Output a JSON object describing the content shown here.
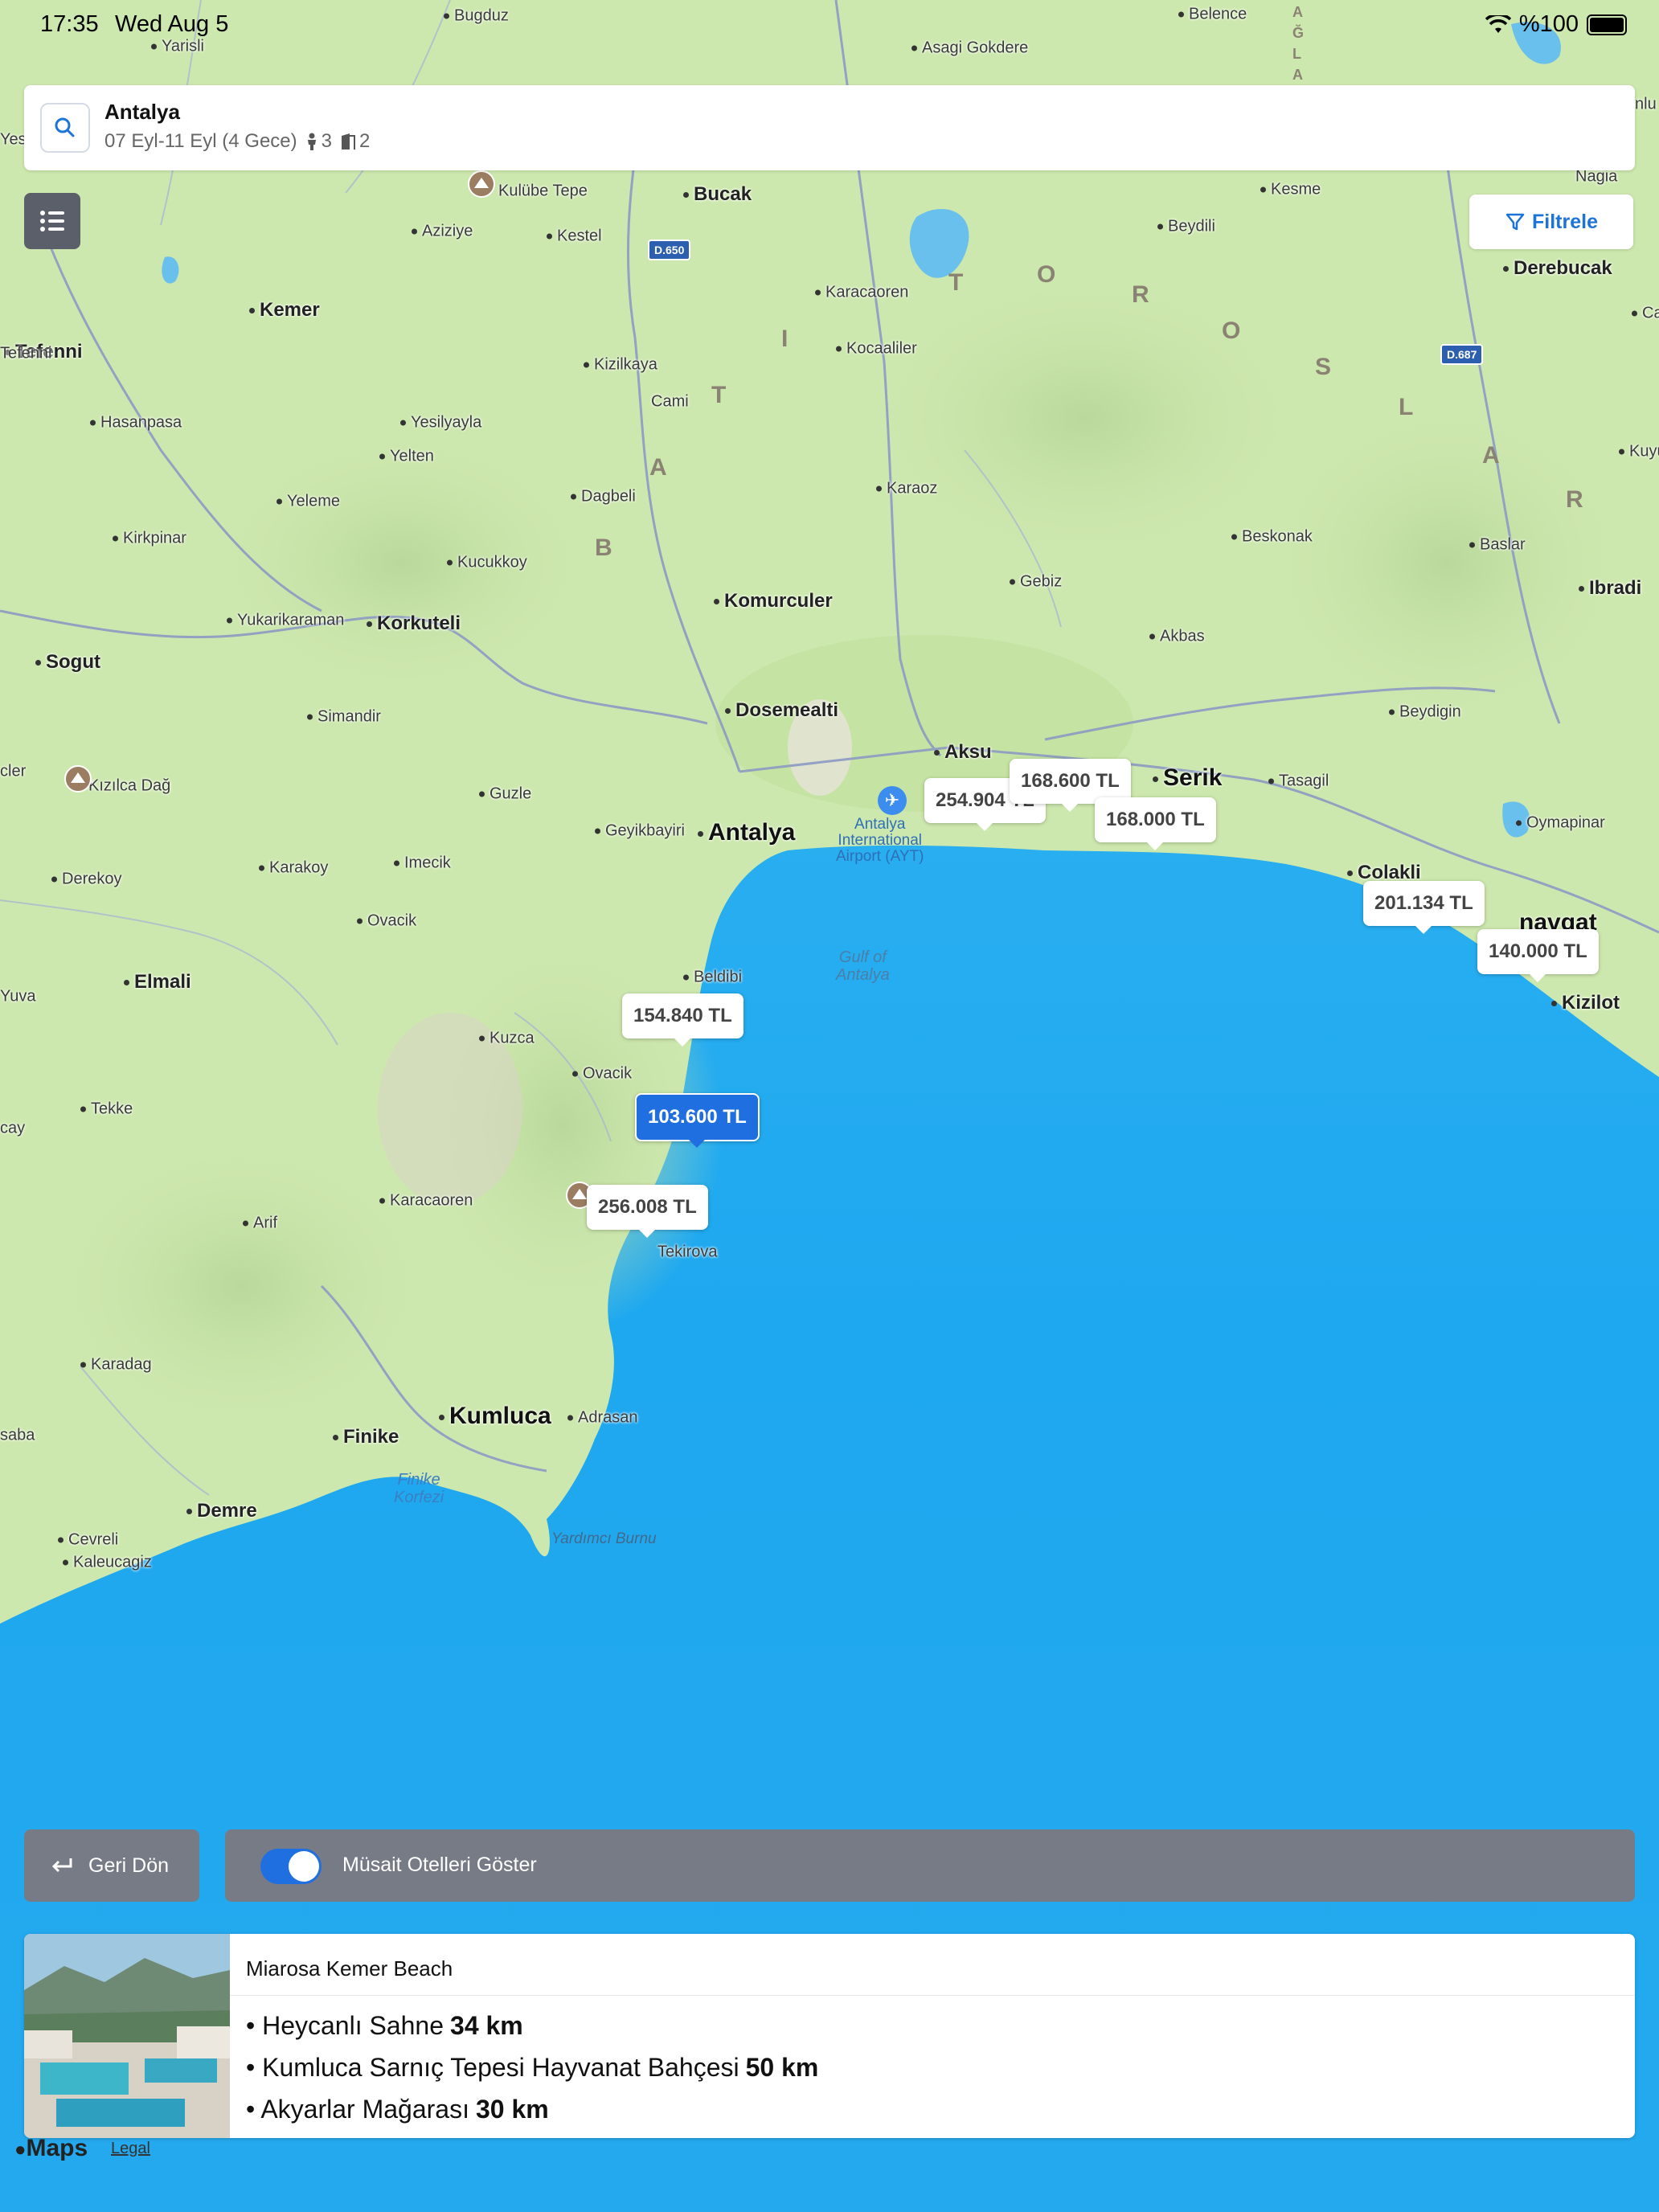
{
  "status_bar": {
    "time": "17:35",
    "date": "Wed Aug 5",
    "battery": "%100"
  },
  "search": {
    "title": "Antalya",
    "dates": "07 Eyl-11 Eyl (4 Gece)",
    "adults": "3",
    "rooms": "2"
  },
  "filter_label": "Filtrele",
  "map": {
    "places": [
      {
        "label": "Bugduz",
        "cls": ""
      },
      {
        "label": "Yarisli",
        "cls": ""
      },
      {
        "label": "Asagi Gokdere",
        "cls": ""
      },
      {
        "label": "Belence",
        "cls": ""
      },
      {
        "label": "Kulübe Tepe",
        "cls": "nodot"
      },
      {
        "label": "Bucak",
        "cls": "mid"
      },
      {
        "label": "Kesme",
        "cls": ""
      },
      {
        "label": "Aziziye",
        "cls": ""
      },
      {
        "label": "Kestel",
        "cls": ""
      },
      {
        "label": "Beydili",
        "cls": ""
      },
      {
        "label": "Derebucak",
        "cls": "mid"
      },
      {
        "label": "Kemer",
        "cls": "mid"
      },
      {
        "label": "Karacaoren",
        "cls": ""
      },
      {
        "label": "Tefenni",
        "cls": "mid"
      },
      {
        "label": "Kocaaliler",
        "cls": ""
      },
      {
        "label": "Kizilkaya",
        "cls": ""
      },
      {
        "label": "Cami",
        "cls": "nodot"
      },
      {
        "label": "Hasanpasa",
        "cls": ""
      },
      {
        "label": "Yesilyayla",
        "cls": ""
      },
      {
        "label": "Yelten",
        "cls": ""
      },
      {
        "label": "Karaoz",
        "cls": ""
      },
      {
        "label": "Dagbeli",
        "cls": ""
      },
      {
        "label": "Yeleme",
        "cls": ""
      },
      {
        "label": "Kirkpinar",
        "cls": ""
      },
      {
        "label": "Beskonak",
        "cls": ""
      },
      {
        "label": "Baslar",
        "cls": ""
      },
      {
        "label": "Kucukkoy",
        "cls": ""
      },
      {
        "label": "Gebiz",
        "cls": ""
      },
      {
        "label": "Ibradi",
        "cls": "mid"
      },
      {
        "label": "Komurculer",
        "cls": "mid"
      },
      {
        "label": "Yukarikaraman",
        "cls": ""
      },
      {
        "label": "Korkuteli",
        "cls": "mid"
      },
      {
        "label": "Akbas",
        "cls": ""
      },
      {
        "label": "Sogut",
        "cls": "mid"
      },
      {
        "label": "Dosemealti",
        "cls": "mid"
      },
      {
        "label": "Beydigin",
        "cls": ""
      },
      {
        "label": "Simandir",
        "cls": ""
      },
      {
        "label": "Aksu",
        "cls": "mid"
      },
      {
        "label": "Serik",
        "cls": "big"
      },
      {
        "label": "Tasagil",
        "cls": ""
      },
      {
        "label": "Kızılca Dağ",
        "cls": "nodot"
      },
      {
        "label": "Guzle",
        "cls": ""
      },
      {
        "label": "Geyikbayiri",
        "cls": ""
      },
      {
        "label": "Antalya",
        "cls": "big"
      },
      {
        "label": "Oymapinar",
        "cls": ""
      },
      {
        "label": "Karakoy",
        "cls": ""
      },
      {
        "label": "Imecik",
        "cls": ""
      },
      {
        "label": "Colakli",
        "cls": "mid"
      },
      {
        "label": "Derekoy",
        "cls": ""
      },
      {
        "label": "Ovacik",
        "cls": ""
      },
      {
        "label": "Elmali",
        "cls": "mid"
      },
      {
        "label": "Beldibi",
        "cls": ""
      },
      {
        "label": "Kizilot",
        "cls": "mid"
      },
      {
        "label": "Kuzca",
        "cls": ""
      },
      {
        "label": "Ovacik",
        "cls": ""
      },
      {
        "label": "Tekke",
        "cls": ""
      },
      {
        "label": "Karacaoren",
        "cls": ""
      },
      {
        "label": "Arif",
        "cls": ""
      },
      {
        "label": "Tekirova",
        "cls": "nodot"
      },
      {
        "label": "Karadag",
        "cls": ""
      },
      {
        "label": "Kumluca",
        "cls": "big"
      },
      {
        "label": "Adrasan",
        "cls": ""
      },
      {
        "label": "Finike",
        "cls": "mid"
      },
      {
        "label": "Demre",
        "cls": "mid"
      },
      {
        "label": "Cevreli",
        "cls": ""
      },
      {
        "label": "Kaleucagiz",
        "cls": ""
      },
      {
        "label": "Yuva",
        "cls": "nodot"
      },
      {
        "label": "Tefenni",
        "cls": "nodot"
      },
      {
        "label": "Kuyu",
        "cls": ""
      },
      {
        "label": "Cam",
        "cls": ""
      },
      {
        "label": "Yes",
        "cls": "nodot"
      },
      {
        "label": "cler",
        "cls": "nodot"
      },
      {
        "label": "cay",
        "cls": "nodot"
      },
      {
        "label": "saba",
        "cls": "nodot"
      },
      {
        "label": "Nagia",
        "cls": "nodot"
      },
      {
        "label": "nlu",
        "cls": "nodot"
      },
      {
        "label": "navgat",
        "cls": "big nodot"
      }
    ],
    "airport_label": "Antalya\nInternational\nAirport (AYT)",
    "gulf_antalya": "Gulf of\nAntalya",
    "gulf_finike": "Finike\nKorfezi",
    "cape": "Yardımcı Burnu",
    "roads": [
      "D.650",
      "D.687"
    ],
    "range_letters": [
      "T",
      "O",
      "R",
      "O",
      "S",
      "L",
      "A",
      "R"
    ],
    "range_letters_west": [
      "B",
      "A",
      "T",
      "I"
    ],
    "range_letters_north": [
      "A",
      "Ğ",
      "L",
      "A"
    ]
  },
  "price_pins": [
    {
      "label": "254.904 TL",
      "active": false
    },
    {
      "label": "168.600 TL",
      "active": false
    },
    {
      "label": "168.000 TL",
      "active": false
    },
    {
      "label": "201.134 TL",
      "active": false
    },
    {
      "label": "140.000 TL",
      "active": false
    },
    {
      "label": "154.840 TL",
      "active": false
    },
    {
      "label": "103.600 TL",
      "active": true
    },
    {
      "label": "256.008 TL",
      "active": false
    }
  ],
  "controls": {
    "back_label": "Geri Dön",
    "toggle_label": "Müsait Otelleri Göster",
    "toggle_on": true
  },
  "hotel": {
    "name": "Miarosa Kemer Beach",
    "pois": [
      {
        "name": "• Heycanlı Sahne",
        "distance": "34 km"
      },
      {
        "name": "• Kumluca Sarnıç Tepesi Hayvanat Bahçesi",
        "distance": "50 km"
      },
      {
        "name": "• Akyarlar Mağarası",
        "distance": "30 km"
      }
    ]
  },
  "attribution": {
    "maps": "Maps",
    "legal": "Legal"
  },
  "colors": {
    "accent": "#1f6fe0",
    "land": "#cfe8b0",
    "sea": "#2ab0f0",
    "panel": "#767b85"
  }
}
